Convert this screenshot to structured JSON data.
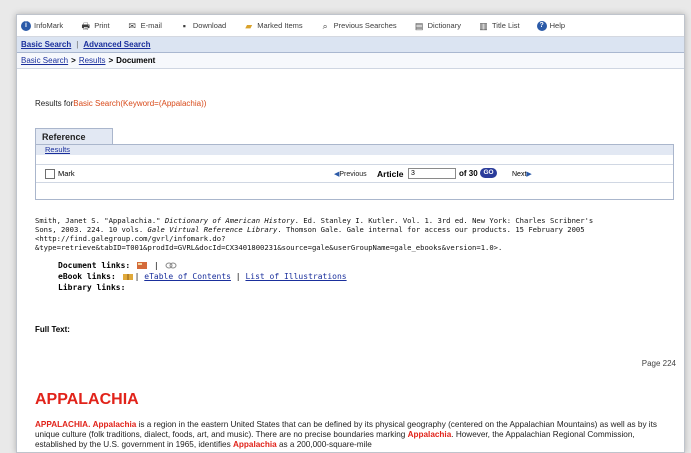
{
  "toolbar": {
    "items": [
      {
        "label": "InfoMark",
        "icon": "infomark-icon"
      },
      {
        "label": "Print",
        "icon": "printer-icon"
      },
      {
        "label": "E-mail",
        "icon": "email-icon"
      },
      {
        "label": "Download",
        "icon": "download-icon"
      },
      {
        "label": "Marked Items",
        "icon": "marked-items-icon"
      },
      {
        "label": "Previous Searches",
        "icon": "previous-searches-icon"
      },
      {
        "label": "Dictionary",
        "icon": "dictionary-icon"
      },
      {
        "label": "Title List",
        "icon": "title-list-icon"
      },
      {
        "label": "Help",
        "icon": "help-icon"
      }
    ]
  },
  "search_nav": {
    "basic": "Basic Search",
    "separator": "|",
    "advanced": "Advanced Search"
  },
  "breadcrumb": {
    "basic": "Basic Search",
    "results": "Results",
    "current": "Document",
    "sep": ">"
  },
  "results_for": {
    "prefix": "Results for",
    "query": "Basic Search(Keyword=(Appalachia))"
  },
  "reference": {
    "tab": "Reference",
    "sub_link": "Results",
    "mark_label": "Mark",
    "previous": "Previous",
    "article_label": "Article",
    "article_value": "3",
    "of_label": "of 30",
    "go": "GO",
    "next": "Next"
  },
  "citation": {
    "line1a": "Smith, Janet S. \"Appalachia.\" ",
    "line1_italic": "Dictionary of American History",
    "line1b": ". Ed. Stanley I. Kutler. Vol. 1. 3rd ed. New York: Charles Scribner's",
    "line2a": "Sons, 2003. 224. 10 vols. ",
    "line2_italic": "Gale Virtual Reference Library",
    "line2b": ". Thomson Gale. Gale internal for access our products. 15 February 2005",
    "line3": "<http://find.galegroup.com/gvrl/infomark.do?",
    "line4": "&type=retrieve&tabID=T001&prodId=GVRL&docId=CX3401800231&source=gale&userGroupName=gale_ebooks&version=1.0>."
  },
  "links": {
    "document_label": "Document links:",
    "ebook_label": "eBook links:",
    "toc_link": "eTable of Contents",
    "sep": "|",
    "illustrations_link": "List of Illustrations",
    "library_label": "Library links:"
  },
  "full_text_label": "Full Text:",
  "page_number": "Page 224",
  "article": {
    "title": "APPALACHIA",
    "p1_hl1": "APPALACHIA.",
    "p1_hl2": "Appalachia",
    "p1_t1": " is a region in the eastern United States that can be defined by its physical geography (centered on the Appalachian",
    "p1_t2": "Mountains) as well as by its unique culture (folk traditions, dialect, foods, art, and music). There are no precise boundaries marking ",
    "p1_hl3": "Appalachia",
    "p1_t3": ".",
    "p1_t4": "However, the Appalachian Regional Commission, established by the U.S. government in 1965, identifies ",
    "p1_hl4": "Appalachia",
    "p1_t5": " as a 200,000-square-mile"
  }
}
